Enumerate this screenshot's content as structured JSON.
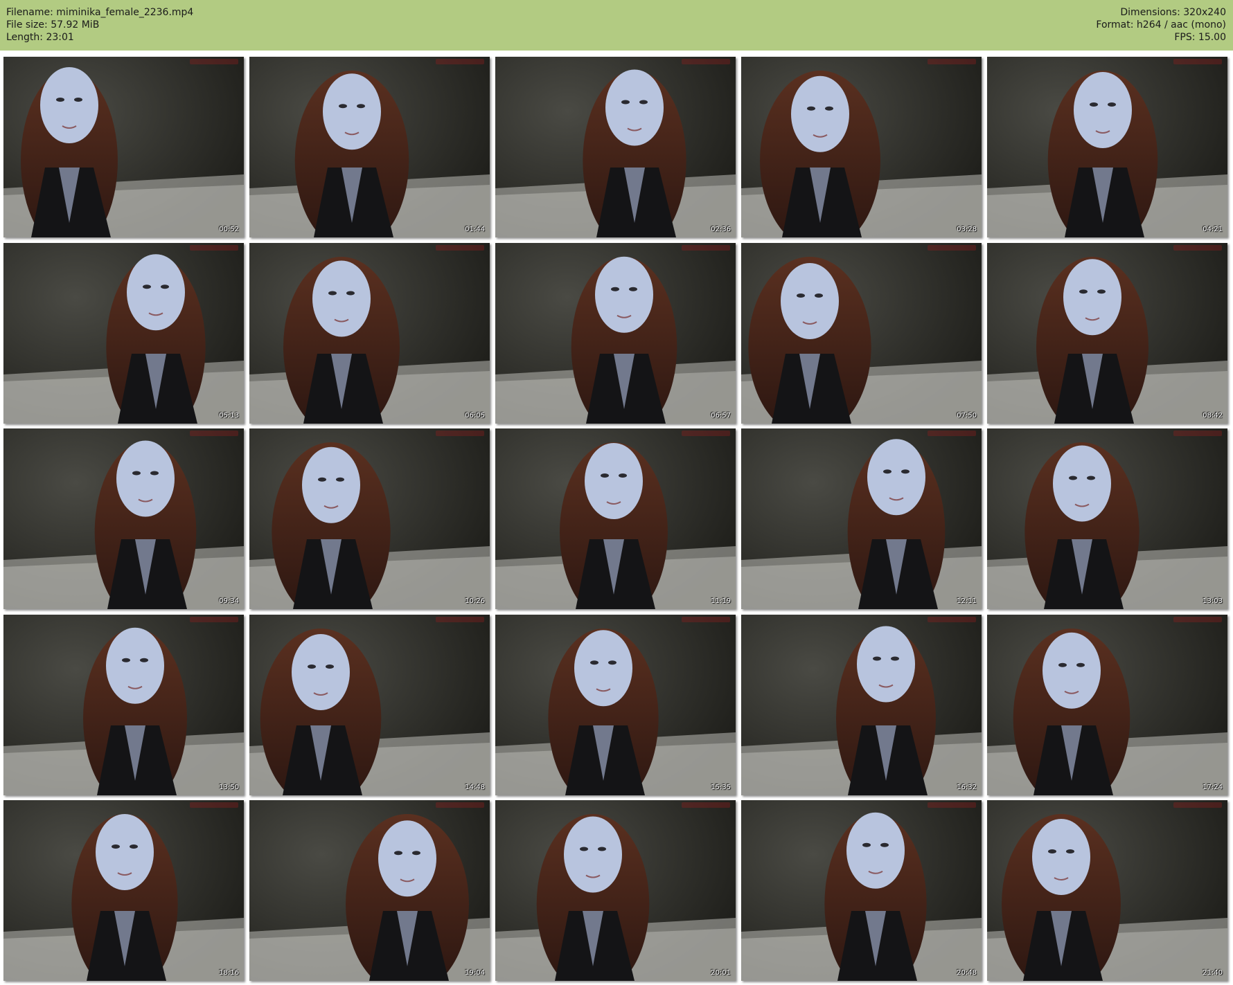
{
  "header": {
    "left": [
      "Filename: miminika_female_2236.mp4",
      "File size: 57.92 MiB",
      "Length: 23:01"
    ],
    "right": [
      "Dimensions: 320x240",
      "Format: h264 / aac (mono)",
      "FPS: 15.00"
    ],
    "background": "#b2cb82"
  },
  "thumbnails": [
    {
      "timestamp": "00:52"
    },
    {
      "timestamp": "01:44"
    },
    {
      "timestamp": "02:36"
    },
    {
      "timestamp": "03:28"
    },
    {
      "timestamp": "04:21"
    },
    {
      "timestamp": "05:13"
    },
    {
      "timestamp": "06:05"
    },
    {
      "timestamp": "06:57"
    },
    {
      "timestamp": "07:50"
    },
    {
      "timestamp": "08:42"
    },
    {
      "timestamp": "09:34"
    },
    {
      "timestamp": "10:26"
    },
    {
      "timestamp": "11:19"
    },
    {
      "timestamp": "12:11"
    },
    {
      "timestamp": "13:03"
    },
    {
      "timestamp": "13:50"
    },
    {
      "timestamp": "14:48"
    },
    {
      "timestamp": "15:35"
    },
    {
      "timestamp": "16:32"
    },
    {
      "timestamp": "17:24"
    },
    {
      "timestamp": "18:16"
    },
    {
      "timestamp": "19:04"
    },
    {
      "timestamp": "20:01"
    },
    {
      "timestamp": "20:48"
    },
    {
      "timestamp": "21:40"
    }
  ]
}
